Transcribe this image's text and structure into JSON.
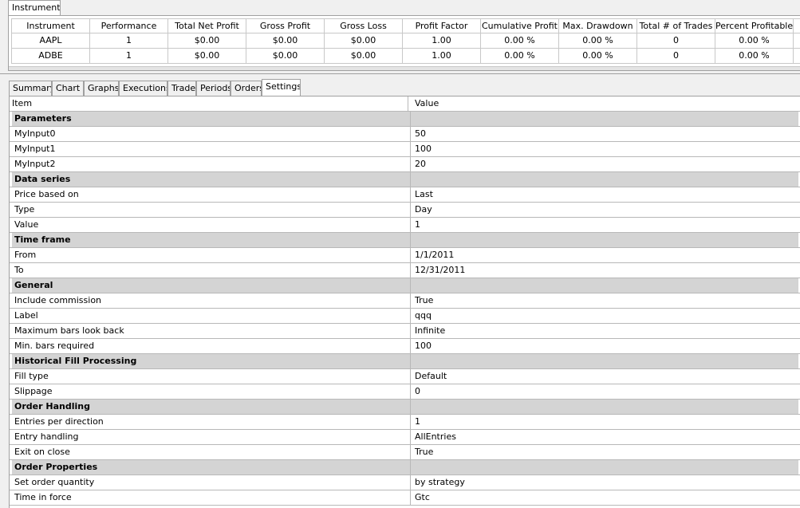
{
  "top_tab": {
    "label": "Instruments"
  },
  "instruments": {
    "columns": [
      "Instrument",
      "Performance",
      "Total Net Profit",
      "Gross Profit",
      "Gross Loss",
      "Profit Factor",
      "Cumulative Profit",
      "Max. Drawdown",
      "Total # of Trades",
      "Percent Profitable"
    ],
    "rows": [
      [
        "AAPL",
        "1",
        "$0.00",
        "$0.00",
        "$0.00",
        "1.00",
        "0.00 %",
        "0.00 %",
        "0",
        "0.00 %"
      ],
      [
        "ADBE",
        "1",
        "$0.00",
        "$0.00",
        "$0.00",
        "1.00",
        "0.00 %",
        "0.00 %",
        "0",
        "0.00 %"
      ]
    ]
  },
  "tabs": [
    "Summary",
    "Chart",
    "Graphs",
    "Executions",
    "Trades",
    "Periods",
    "Orders",
    "Settings"
  ],
  "active_tab": "Settings",
  "settings": {
    "header": {
      "item": "Item",
      "value": "Value"
    },
    "rows": [
      {
        "type": "category",
        "label": "Parameters"
      },
      {
        "type": "item",
        "label": "MyInput0",
        "value": "50"
      },
      {
        "type": "item",
        "label": "MyInput1",
        "value": "100"
      },
      {
        "type": "item",
        "label": "MyInput2",
        "value": "20"
      },
      {
        "type": "category",
        "label": "Data series"
      },
      {
        "type": "item",
        "label": "Price based on",
        "value": "Last"
      },
      {
        "type": "item",
        "label": "Type",
        "value": "Day"
      },
      {
        "type": "item",
        "label": "Value",
        "value": "1"
      },
      {
        "type": "category",
        "label": "Time frame"
      },
      {
        "type": "item",
        "label": "From",
        "value": "1/1/2011"
      },
      {
        "type": "item",
        "label": "To",
        "value": "12/31/2011"
      },
      {
        "type": "category",
        "label": "General"
      },
      {
        "type": "item",
        "label": "Include commission",
        "value": "True"
      },
      {
        "type": "item",
        "label": "Label",
        "value": "qqq"
      },
      {
        "type": "item",
        "label": "Maximum bars look back",
        "value": "Infinite"
      },
      {
        "type": "item",
        "label": "Min. bars required",
        "value": "100"
      },
      {
        "type": "category",
        "label": "Historical Fill Processing"
      },
      {
        "type": "item",
        "label": "Fill type",
        "value": "Default"
      },
      {
        "type": "item",
        "label": "Slippage",
        "value": "0"
      },
      {
        "type": "category",
        "label": "Order Handling"
      },
      {
        "type": "item",
        "label": "Entries per direction",
        "value": "1"
      },
      {
        "type": "item",
        "label": "Entry handling",
        "value": "AllEntries"
      },
      {
        "type": "item",
        "label": "Exit on close",
        "value": "True"
      },
      {
        "type": "category",
        "label": "Order Properties"
      },
      {
        "type": "item",
        "label": "Set order quantity",
        "value": "by strategy"
      },
      {
        "type": "item",
        "label": "Time in force",
        "value": "Gtc"
      }
    ]
  }
}
